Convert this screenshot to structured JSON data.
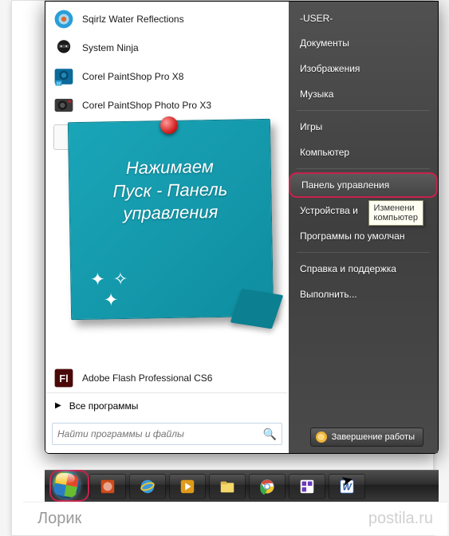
{
  "programs": [
    {
      "label": "Sqirlz Water Reflections",
      "icon": "sqirlz"
    },
    {
      "label": "System Ninja",
      "icon": "ninja"
    },
    {
      "label": "Corel PaintShop Pro X8",
      "icon": "psp"
    },
    {
      "label": "Corel PaintShop Photo Pro X3",
      "icon": "psp3"
    }
  ],
  "flash_label": "Adobe Flash Professional CS6",
  "all_programs": "Все программы",
  "search_placeholder": "Найти программы и файлы",
  "right_items": {
    "user": "-USER-",
    "docs": "Документы",
    "pics": "Изображения",
    "music": "Музыка",
    "games": "Игры",
    "computer": "Компьютер",
    "control_panel": "Панель управления",
    "devices": "Устройства и",
    "defaults": "Программы по умолчан",
    "help": "Справка и поддержка",
    "run": "Выполнить..."
  },
  "tooltip": {
    "l1": "Изменени",
    "l2": "компьютер"
  },
  "shutdown_label": "Завершение работы",
  "note": {
    "l1": "Нажимаем",
    "l2": "Пуск - Панель",
    "l3": "управления"
  },
  "attribution": {
    "name": "Лорик",
    "site": "postila.ru"
  }
}
